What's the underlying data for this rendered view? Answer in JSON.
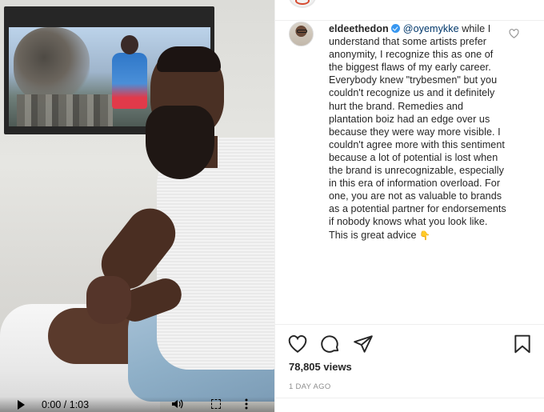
{
  "video": {
    "current_time": "0:00",
    "duration": "1:03",
    "time_display": "0:00 / 1:03",
    "progress": 0
  },
  "post": {
    "comment": {
      "username": "eldeethedon",
      "verified": true,
      "mention": "@oyemykke",
      "text": "while I understand that some artists prefer anonymity, I recognize this as one of the biggest flaws of my early career. Everybody knew \"trybesmen\" but you couldn't recognize us and it definitely hurt the brand. Remedies and plantation boiz had an edge over us because they were way more visible. I couldn't agree more with this sentiment because a lot of potential is lost when the brand is unrecognizable, especially in this era of information overload. For one, you are not as valuable to brands as a potential partner for endorsements if nobody knows what you look like. This is great advice",
      "emoji": "👇"
    },
    "views": "78,805 views",
    "time_ago": "1 DAY AGO"
  },
  "colors": {
    "verified_badge": "#3897f0",
    "mention": "#00376b",
    "meta_gray": "#8e8e8e",
    "text": "#262626"
  },
  "icons": [
    "play-icon",
    "volume-icon",
    "fullscreen-icon",
    "more-icon",
    "heart-icon",
    "comment-icon",
    "share-icon",
    "save-icon",
    "verified-icon",
    "like-comment-icon"
  ]
}
